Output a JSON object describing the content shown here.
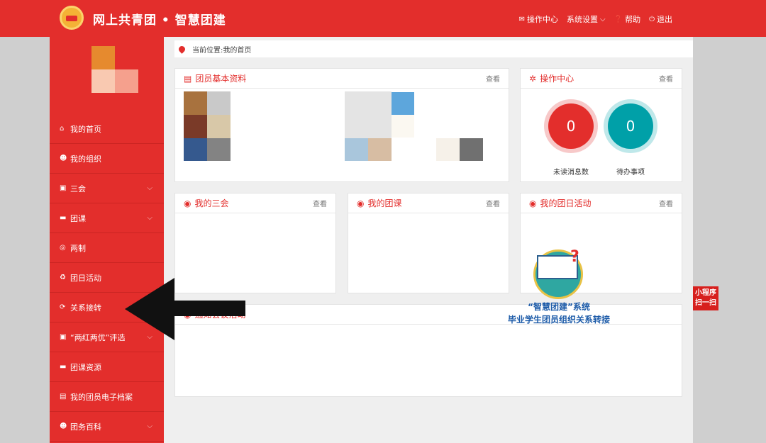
{
  "header": {
    "title": "网上共青团 • 智慧团建"
  },
  "topnav": [
    {
      "label": "操作中心",
      "icon": "envelope-icon"
    },
    {
      "label": "系统设置",
      "icon": "chevron-down-icon"
    },
    {
      "label": "帮助",
      "icon": "question-icon"
    },
    {
      "label": "退出",
      "icon": "power-icon"
    }
  ],
  "sidebar": {
    "items": [
      {
        "label": "我的首页",
        "icon": "home-icon"
      },
      {
        "label": "我的组织",
        "icon": "users-icon"
      },
      {
        "label": "三会",
        "icon": "edit-icon"
      },
      {
        "label": "团课",
        "icon": "folder-icon"
      },
      {
        "label": "两制",
        "icon": "target-icon"
      },
      {
        "label": "团日活动",
        "icon": "recycle-icon"
      },
      {
        "label": "关系接转",
        "icon": "refresh-icon"
      },
      {
        "label": "“两红两优”评选",
        "icon": "edit-icon"
      },
      {
        "label": "团课资源",
        "icon": "folder-icon"
      },
      {
        "label": "我的团员电子档案",
        "icon": "file-icon"
      },
      {
        "label": "团务百科",
        "icon": "users-icon"
      }
    ]
  },
  "breadcrumb": "当前位置:我的首页",
  "panels": {
    "basic": {
      "title": "团员基本资料",
      "more": "查看"
    },
    "ops": {
      "title": "操作中心",
      "more": "查看",
      "unread": "0",
      "unread_label": "未读消息数",
      "todo": "0",
      "todo_label": "待办事项"
    },
    "sanhui": {
      "title": "我的三会",
      "more": "查看"
    },
    "tuanke": {
      "title": "我的团课",
      "more": "查看"
    },
    "tuanri": {
      "title": "我的团日活动",
      "more": "查看"
    },
    "bottom": {
      "title": "通知会议活动"
    }
  },
  "promo": {
    "line1": "“智慧团建”系统",
    "line2": "毕业学生团员组织关系转接"
  },
  "badge": {
    "line1": "小程序",
    "line2": "扫一扫"
  },
  "colors": {
    "brand": "#e32e2c",
    "teal": "#00a0a8",
    "promo": "#1b5aa8"
  }
}
